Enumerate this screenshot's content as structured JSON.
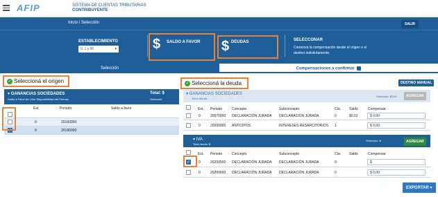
{
  "brand": {
    "logo_text": "AFIP",
    "line1": "SISTEMA DE CUENTAS TRIBUTARIAS",
    "line2": "CONTRIBUYENTE"
  },
  "breadcrumb": "Inicio /  Selección",
  "salir": "SALIR",
  "establecimiento": {
    "label": "ESTABLECIMIENTO",
    "value": "0, 1 y 90"
  },
  "cards": {
    "saldo": "SALDO A FAVOR",
    "deudas": "DEUDAS",
    "dollar": "$"
  },
  "compensar": {
    "title": "SELECCONAR",
    "desc": "Comenzá la compensación desde el origen o el destino indistintamente."
  },
  "tabs": {
    "seleccion": "Selección",
    "compensaciones": "Compensaciones a confirmar"
  },
  "origen": {
    "heading": "Seleccioná el origen",
    "panel_title": "GANANCIAS SOCIEDADES",
    "panel_sub": "Saldo a Favor de Libre Disponibilidad del Período",
    "total_label": "Total: $",
    "total_sub": "Selección",
    "headers": [
      "Est.",
      "Periodo",
      "Saldo a favor"
    ],
    "rows": [
      {
        "est": "",
        "periodo": "",
        "saldo": ""
      },
      {
        "est": "0",
        "periodo": "20160000",
        "saldo": ""
      },
      {
        "est": "0",
        "periodo": "20180000",
        "saldo": ""
      }
    ]
  },
  "deuda": {
    "heading": "Seleccioná la deuda",
    "destino": "DESTINO MANUAL",
    "ganancias": {
      "title": "GANANCIAS SOCIEDADES",
      "sub": "Tiene deuda",
      "seleccion": "Selección: $0,00",
      "agregar": "AGREGAR",
      "headers": [
        "Est.",
        "Periodo",
        "Concepto",
        "Subconcepto",
        "Cta.",
        "Saldo",
        "Compensar"
      ],
      "rows": [
        {
          "est": "0",
          "periodo": "20070000",
          "concepto": "DECLARACIÓN JURADA",
          "subconcepto": "DECLARACIÓN JURADA",
          "cta": "0",
          "saldo": "$0,01",
          "compensar": "$ 0,00"
        },
        {
          "est": "0",
          "periodo": "20200000",
          "concepto": "ANTICIPOS",
          "subconcepto": "INTERESES RESARCITORIOS",
          "cta": "1",
          "saldo": "",
          "compensar": "$ 0,00"
        }
      ]
    },
    "iva": {
      "title": "IVA",
      "sub": "Total deuda: $",
      "seleccion": "Selección: $",
      "agregar": "AGREGAR",
      "headers": [
        "Est.",
        "Periodo",
        "Concepto",
        "Subconcepto",
        "Cta.",
        "Saldo",
        "Compensar"
      ],
      "rows": [
        {
          "est": "0",
          "periodo": "20200500",
          "concepto": "DECLARACIÓN JURADA",
          "subconcepto": "DECLARACIÓN JURADA",
          "cta": "0",
          "saldo": "",
          "compensar": "$"
        },
        {
          "est": "0",
          "periodo": "20200600",
          "concepto": "DECLARACIÓN JURADA",
          "subconcepto": "DECLARACIÓN JURADA",
          "cta": "0",
          "saldo": "",
          "compensar": "$ 0,00"
        }
      ]
    }
  },
  "exportar": "EXPORTAR ▾",
  "colors": {
    "primary": "#1f5f99",
    "highlight": "#e8823a",
    "agregar": "#2e8b3a"
  }
}
